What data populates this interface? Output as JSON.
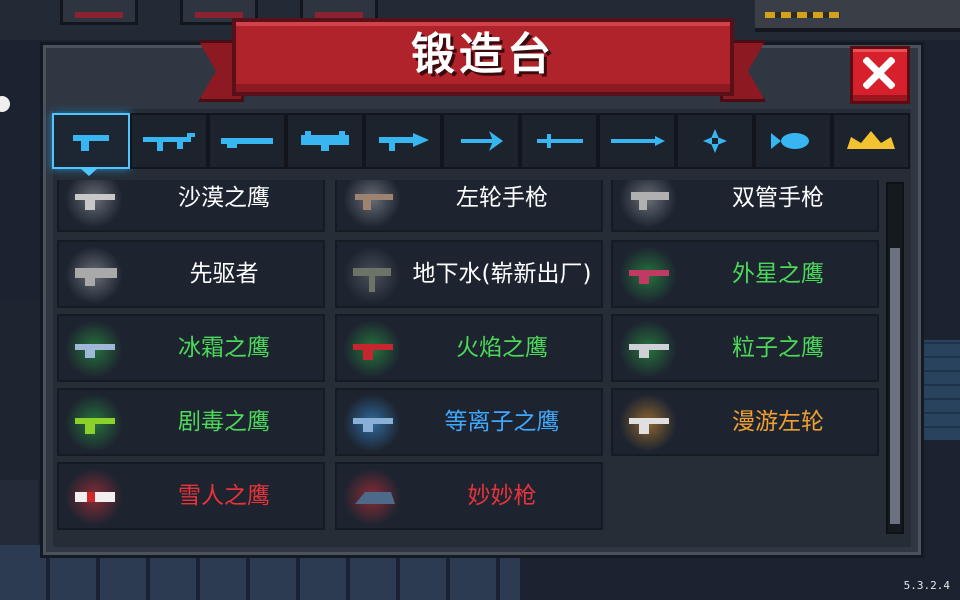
{
  "title": "锻造台",
  "version": "5.3.2.4",
  "colors": {
    "white": "#ffffff",
    "green": "#4cd95a",
    "blue": "#3fa8ff",
    "orange": "#f0a030",
    "red": "#e8333a",
    "accent": "#4fc6ff"
  },
  "tabs": [
    {
      "icon": "pistol-icon",
      "selected": true
    },
    {
      "icon": "rifle-icon",
      "selected": false
    },
    {
      "icon": "shotgun-icon",
      "selected": false
    },
    {
      "icon": "launcher-icon",
      "selected": false
    },
    {
      "icon": "laser-gun-icon",
      "selected": false
    },
    {
      "icon": "bow-icon",
      "selected": false
    },
    {
      "icon": "sword-icon",
      "selected": false
    },
    {
      "icon": "spear-icon",
      "selected": false
    },
    {
      "icon": "shuriken-icon",
      "selected": false
    },
    {
      "icon": "fish-icon",
      "selected": false
    },
    {
      "icon": "crown-icon",
      "selected": false
    }
  ],
  "weapons": [
    {
      "name": "沙漠之鹰",
      "rarity": "white"
    },
    {
      "name": "左轮手枪",
      "rarity": "white"
    },
    {
      "name": "双管手枪",
      "rarity": "white"
    },
    {
      "name": "先驱者",
      "rarity": "white"
    },
    {
      "name": "地下水(崭新出厂)",
      "rarity": "white"
    },
    {
      "name": "外星之鹰",
      "rarity": "green"
    },
    {
      "name": "冰霜之鹰",
      "rarity": "green"
    },
    {
      "name": "火焰之鹰",
      "rarity": "green"
    },
    {
      "name": "粒子之鹰",
      "rarity": "green"
    },
    {
      "name": "剧毒之鹰",
      "rarity": "green"
    },
    {
      "name": "等离子之鹰",
      "rarity": "blue"
    },
    {
      "name": "漫游左轮",
      "rarity": "orange"
    },
    {
      "name": "雪人之鹰",
      "rarity": "red"
    },
    {
      "name": "妙妙枪",
      "rarity": "red"
    }
  ]
}
